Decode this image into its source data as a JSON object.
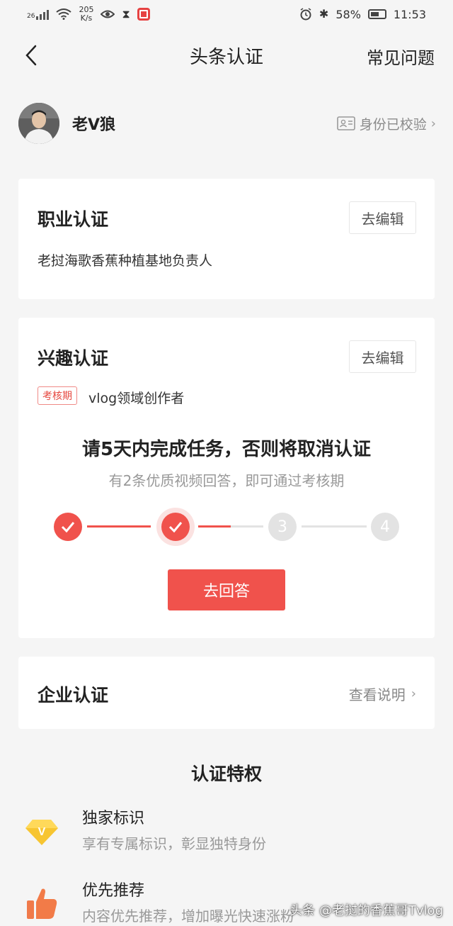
{
  "status_bar": {
    "network": "26",
    "speed_value": "205",
    "speed_unit": "K/s",
    "battery": "58%",
    "time": "11:53"
  },
  "nav": {
    "title": "头条认证",
    "faq": "常见问题",
    "back_icon": "chevron-left-icon"
  },
  "profile": {
    "name": "老V狼",
    "verified_label": "身份已校验"
  },
  "career_card": {
    "title": "职业认证",
    "edit_label": "去编辑",
    "description": "老挝海歌香蕉种植基地负责人"
  },
  "interest_card": {
    "title": "兴趣认证",
    "edit_label": "去编辑",
    "tag": "考核期",
    "field": "vlog领域创作者",
    "task_title": "请5天内完成任务，否则将取消认证",
    "task_subtitle": "有2条优质视频回答，即可通过考核期",
    "steps": [
      {
        "label": "",
        "state": "done"
      },
      {
        "label": "",
        "state": "done-current"
      },
      {
        "label": "3",
        "state": "todo"
      },
      {
        "label": "4",
        "state": "todo"
      }
    ],
    "progress_after_step2": 0.5,
    "answer_button": "去回答"
  },
  "enterprise_card": {
    "title": "企业认证",
    "link_label": "查看说明"
  },
  "privileges": {
    "heading": "认证特权",
    "items": [
      {
        "title": "独家标识",
        "description": "享有专属标识，彰显独特身份",
        "icon": "gold-diamond-v-icon"
      },
      {
        "title": "优先推荐",
        "description": "内容优先推荐，增加曝光快速涨粉",
        "icon": "thumbs-up-icon"
      }
    ]
  },
  "watermark": "头条 @老挝的香蕉哥Tvlog",
  "colors": {
    "accent": "#f0524c",
    "background": "#f5f5f5",
    "card": "#ffffff",
    "muted_text": "#999999",
    "gold": "#f5c518"
  }
}
